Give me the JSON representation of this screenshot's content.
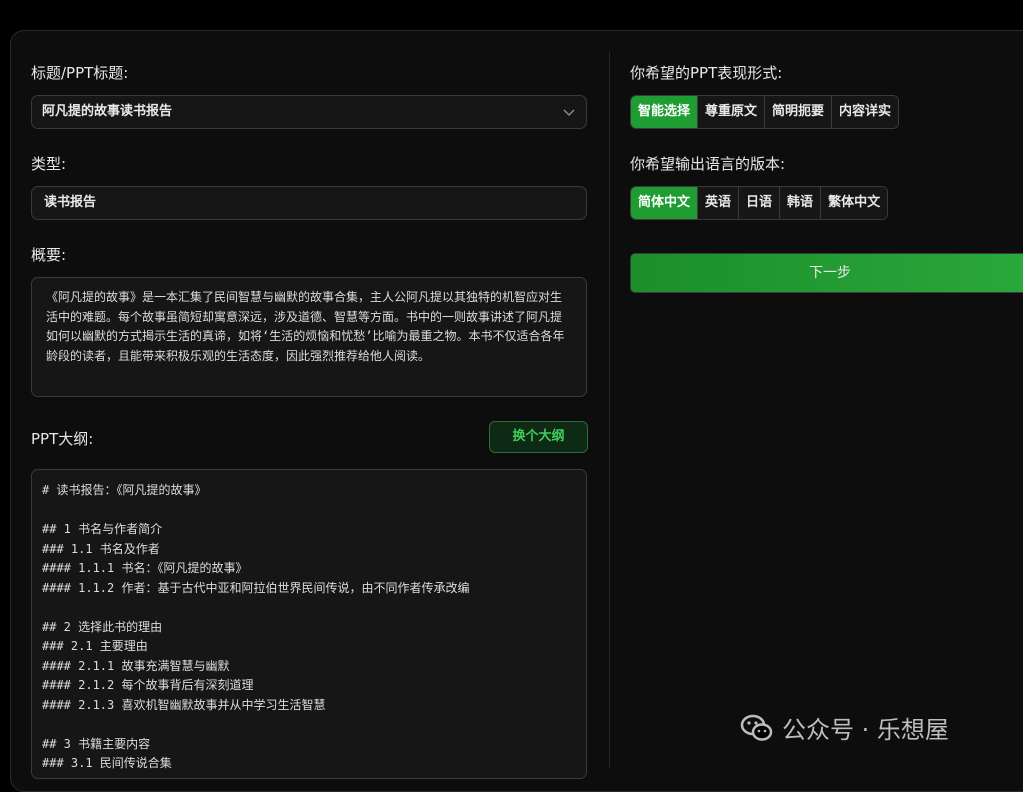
{
  "left": {
    "title_label": "标题/PPT标题:",
    "title_value": "阿凡提的故事读书报告",
    "type_label": "类型:",
    "type_value": "读书报告",
    "summary_label": "概要:",
    "summary_text": "《阿凡提的故事》是一本汇集了民间智慧与幽默的故事合集，主人公阿凡提以其独特的机智应对生活中的难题。每个故事虽简短却寓意深远，涉及道德、智慧等方面。书中的一则故事讲述了阿凡提如何以幽默的方式揭示生活的真谛，如将‘生活的烦恼和忧愁’比喻为最重之物。本书不仅适合各年龄段的读者，且能带来积极乐观的生活态度，因此强烈推荐给他人阅读。",
    "outline_label": "PPT大纲:",
    "swap_button": "换个大纲",
    "outline_text": "# 读书报告：《阿凡提的故事》\n\n## 1 书名与作者简介\n### 1.1 书名及作者\n#### 1.1.1 书名：《阿凡提的故事》\n#### 1.1.2 作者：基于古代中亚和阿拉伯世界民间传说，由不同作者传承改编\n\n## 2 选择此书的理由\n### 2.1 主要理由\n#### 2.1.1 故事充满智慧与幽默\n#### 2.1.2 每个故事背后有深刻道理\n#### 2.1.3 喜欢机智幽默故事并从中学习生活智慧\n\n## 3 书籍主要内容\n### 3.1 民间传说合集"
  },
  "right": {
    "style_label": "你希望的PPT表现形式:",
    "style_options": [
      "智能选择",
      "尊重原文",
      "简明扼要",
      "内容详实"
    ],
    "language_label": "你希望输出语言的版本:",
    "language_options": [
      "简体中文",
      "英语",
      "日语",
      "韩语",
      "繁体中文"
    ],
    "next_button": "下一步"
  },
  "watermark": "公众号 · 乐想屋",
  "colors": {
    "accent": "#1f9d33",
    "background": "#000000",
    "panel": "#0d0d0d"
  }
}
